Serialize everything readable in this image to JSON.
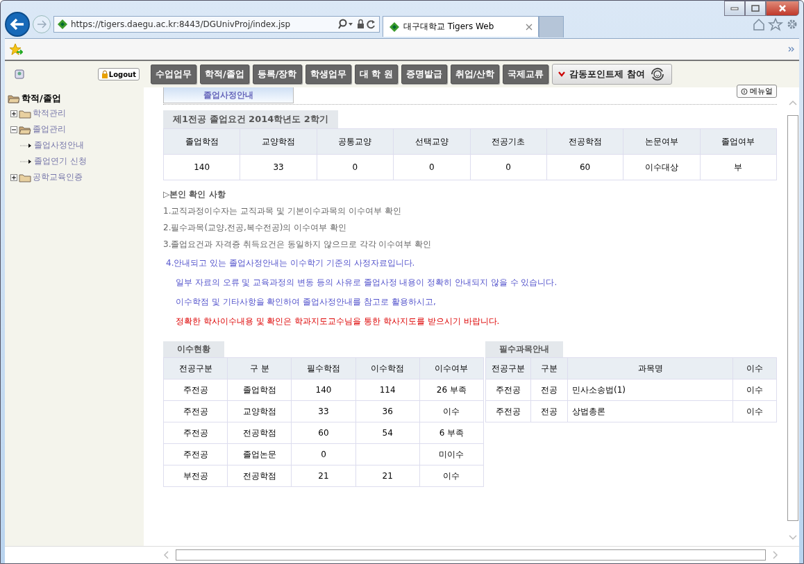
{
  "browser": {
    "url": "https://tigers.daegu.ac.kr:8443/DGUnivProj/index.jsp",
    "tabs": [
      {
        "label": "대구대학교 Tigers Web",
        "selected": true
      }
    ]
  },
  "header": {
    "logout": "Logout",
    "menu": [
      {
        "label": "수업업무"
      },
      {
        "label": "학적/졸업"
      },
      {
        "label": "등록/장학"
      },
      {
        "label": "학생업무"
      },
      {
        "label": "대 학 원"
      },
      {
        "label": "증명발급"
      },
      {
        "label": "취업/산학"
      },
      {
        "label": "국제교류"
      }
    ],
    "point_button": "감동포인트제 참여"
  },
  "sidebar": {
    "title": "학적/졸업",
    "items": [
      {
        "label": "학적관리",
        "expanded": false
      },
      {
        "label": "졸업관리",
        "expanded": true,
        "children": [
          {
            "label": "졸업사정안내"
          },
          {
            "label": "졸업연기 신청"
          }
        ]
      },
      {
        "label": "공학교육인증",
        "expanded": false
      }
    ]
  },
  "page_tabs": [
    {
      "label": "졸업사정안내",
      "selected": true
    }
  ],
  "manual_button": "메뉴얼",
  "requirements": {
    "caption": "제1전공 졸업요건 2014학년도 2학기",
    "columns": [
      "졸업학점",
      "교양학점",
      "공통교양",
      "선택교양",
      "전공기초",
      "전공학점",
      "논문여부",
      "졸업여부"
    ],
    "values": [
      "140",
      "33",
      "0",
      "0",
      "0",
      "60",
      "이수대상",
      "부"
    ]
  },
  "notes": {
    "title": "▷본인 확인 사항",
    "lines": [
      {
        "kind": "plain",
        "text": "1.교직과정이수자는 교직과목 및 기본이수과목의 이수여부 확인"
      },
      {
        "kind": "plain",
        "text": "2.필수과목(교양,전공,복수전공)의 이수여부 확인"
      },
      {
        "kind": "plain",
        "text": "3.졸업요건과 자격증 취득요건은 동일하지 않으므로 각각 이수여부 확인"
      },
      {
        "kind": "info",
        "text": "4.안내되고 있는 졸업사정안내는 이수학기 기준의 사정자료입니다."
      },
      {
        "kind": "info_sub",
        "text": "일부 자료의 오류 및 교육과정의 변동 등의 사유로 졸업사정 내용이 정확히 안내되지 않을 수 있습니다."
      },
      {
        "kind": "info_sub",
        "text": "이수학점 및 기타사항을 확인하여 졸업사정안내를 참고로 활용하시고,"
      },
      {
        "kind": "warning",
        "text": "정확한 학사이수내용 및 확인은 학과지도교수님을 통한 학사지도를 받으시기 바랍니다."
      }
    ]
  },
  "completion": {
    "caption": "이수현황",
    "columns": [
      "전공구분",
      "구 분",
      "필수학점",
      "이수학점",
      "이수여부"
    ],
    "rows": [
      [
        "주전공",
        "졸업학점",
        "140",
        "114",
        "26 부족"
      ],
      [
        "주전공",
        "교양학점",
        "33",
        "36",
        "이수"
      ],
      [
        "주전공",
        "전공학점",
        "60",
        "54",
        "6 부족"
      ],
      [
        "주전공",
        "졸업논문",
        "0",
        "",
        "미이수"
      ],
      [
        "부전공",
        "전공학점",
        "21",
        "21",
        "이수"
      ]
    ]
  },
  "required_courses": {
    "caption": "필수과목안내",
    "columns": [
      "전공구분",
      "구분",
      "과목명",
      "이수"
    ],
    "rows": [
      [
        "주전공",
        "전공",
        "민사소송법(1)",
        "이수"
      ],
      [
        "주전공",
        "전공",
        "상법총론",
        "이수"
      ]
    ]
  }
}
